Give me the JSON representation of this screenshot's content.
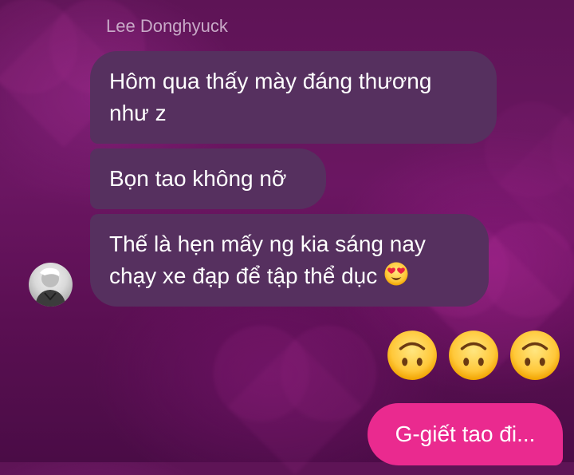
{
  "conversation": {
    "sender_name": "Lee Donghyuck",
    "received": [
      {
        "text": "Hôm qua thấy mày đáng thương",
        "text_line2": "như z"
      },
      {
        "text": "Bọn tao không nỡ"
      },
      {
        "text": "Thế là hẹn mấy ng kia sáng nay",
        "text_line2": "chạy xe đạp để tập thể dục",
        "emoji": "heart-eyes-emoji"
      }
    ],
    "reaction_emojis": [
      "upside-down-face-icon",
      "upside-down-face-icon",
      "upside-down-face-icon"
    ],
    "sent": [
      {
        "text": "G-giết tao đi..."
      }
    ]
  },
  "theme": {
    "background_base": "#5e1456",
    "received_bubble": "#56305f",
    "sent_bubble": "#ea2a8f",
    "sender_name_color": "#c8a9c7"
  }
}
